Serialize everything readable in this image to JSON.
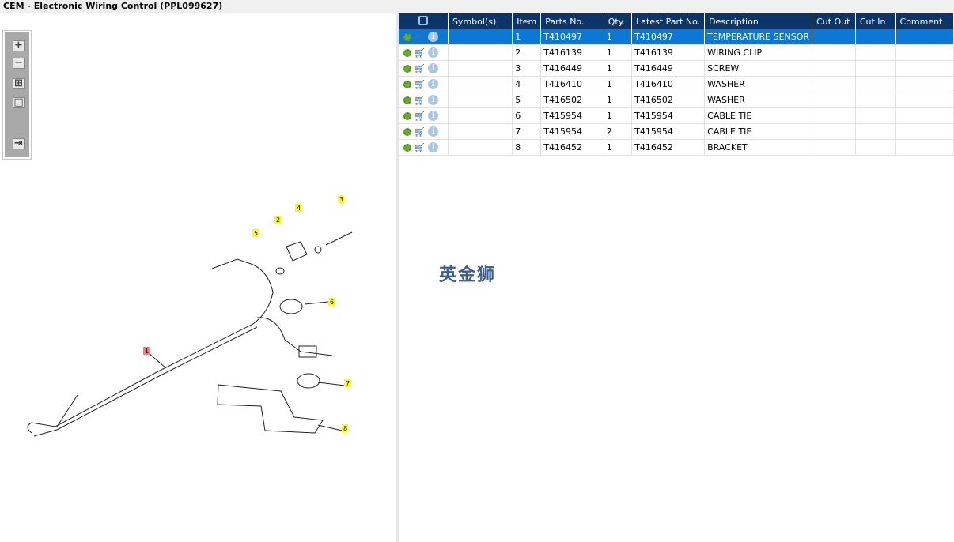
{
  "title": "CEM - Electronic Wiring Control (PPL099627)",
  "toolbar": {
    "zoom_in": "+",
    "zoom_out": "−",
    "fit": "⊞",
    "reset": "□",
    "export": "⇥"
  },
  "table": {
    "columns": [
      "",
      "Symbol(s)",
      "Item",
      "Parts No.",
      "Qty.",
      "Latest Part No.",
      "Description",
      "Cut Out",
      "Cut In",
      "Comment"
    ],
    "rows": [
      {
        "item": "1",
        "part": "T410497",
        "qty": "1",
        "latest": "T410497",
        "desc": "TEMPERATURE SENSOR",
        "selected": true
      },
      {
        "item": "2",
        "part": "T416139",
        "qty": "1",
        "latest": "T416139",
        "desc": "WIRING CLIP"
      },
      {
        "item": "3",
        "part": "T416449",
        "qty": "1",
        "latest": "T416449",
        "desc": "SCREW"
      },
      {
        "item": "4",
        "part": "T416410",
        "qty": "1",
        "latest": "T416410",
        "desc": "WASHER"
      },
      {
        "item": "5",
        "part": "T416502",
        "qty": "1",
        "latest": "T416502",
        "desc": "WASHER"
      },
      {
        "item": "6",
        "part": "T415954",
        "qty": "1",
        "latest": "T415954",
        "desc": "CABLE TIE"
      },
      {
        "item": "7",
        "part": "T415954",
        "qty": "2",
        "latest": "T415954",
        "desc": "CABLE TIE"
      },
      {
        "item": "8",
        "part": "T416452",
        "qty": "1",
        "latest": "T416452",
        "desc": "BRACKET"
      }
    ]
  },
  "diagram": {
    "callouts": [
      "1",
      "2",
      "3",
      "4",
      "5",
      "6",
      "7",
      "8"
    ],
    "highlight_color": "#f08080",
    "callout_color": "#ffff00"
  },
  "watermark": "英金狮",
  "colors": {
    "header": "#0b3468",
    "selected": "#0a78d4"
  }
}
